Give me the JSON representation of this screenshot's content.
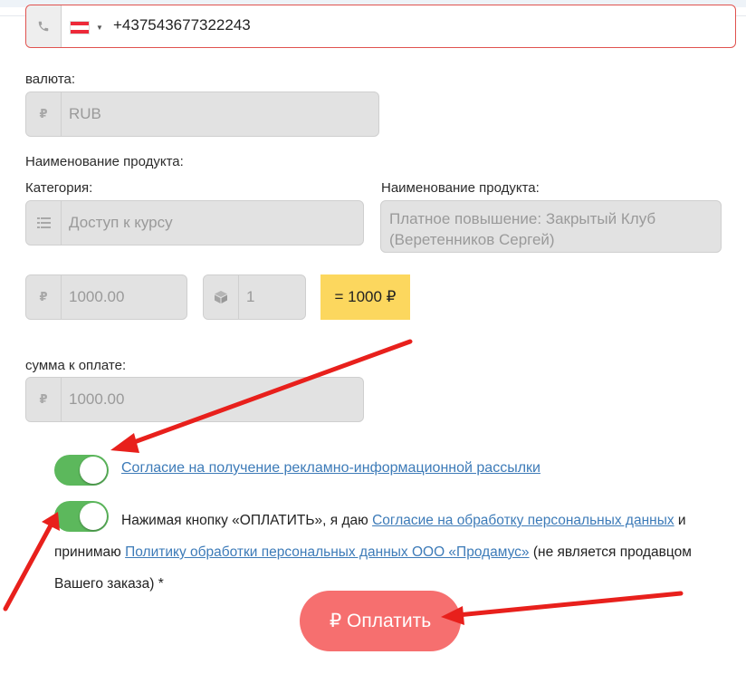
{
  "phone": {
    "icon": "phone-icon",
    "country": "Austria",
    "value": "+437543677322243"
  },
  "currency": {
    "label": "валюта:",
    "icon": "ruble-icon",
    "value": "RUB"
  },
  "product": {
    "section_label": "Наименование продукта:",
    "category_label": "Категория:",
    "category_icon": "list-icon",
    "category_value": "Доступ к курсу",
    "name_label": "Наименование продукта:",
    "name_value": "Платное повышение: Закрытый Клуб (Веретенников Сергей)",
    "price_icon": "ruble-icon",
    "price_value": "1000.00",
    "qty_icon": "box-icon",
    "qty_value": "1",
    "total": "= 1000 ₽"
  },
  "payment": {
    "sum_label": "сумма к оплате:",
    "sum_icon": "ruble-icon",
    "sum_value": "1000.00"
  },
  "consent": {
    "newsletter_link": "Согласие на получение рекламно-информационной рассылки",
    "newsletter_checked": true,
    "privacy_checked": true,
    "privacy_text_1": "Нажимая кнопку «ОПЛАТИТЬ», я даю ",
    "privacy_link_1": "Согласие на обработку персональных данных",
    "privacy_text_2": " и принимаю ",
    "privacy_link_2": "Политику обработки персональных данных ООО «Продамус»",
    "privacy_text_3": " (не является продавцом Вашего заказа) *"
  },
  "button": {
    "pay_label": "₽ Оплатить"
  },
  "colors": {
    "toggle_on": "#5cb85c",
    "pay_button": "#f66f6f",
    "total_highlight": "#fcd75e",
    "link": "#3d7bb8",
    "error_border": "#e0524f",
    "annotation_arrow": "#e8201c"
  }
}
